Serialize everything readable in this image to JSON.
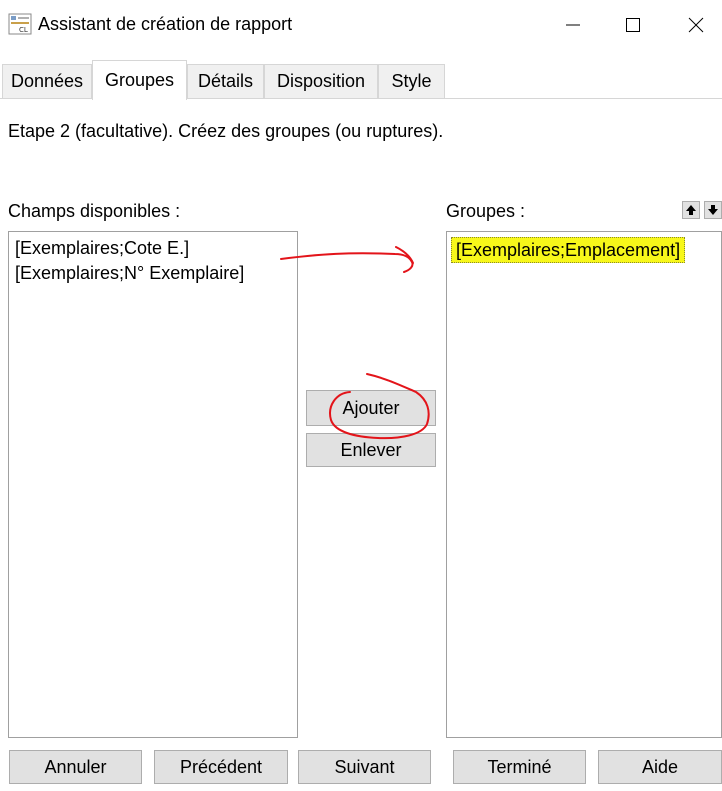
{
  "window": {
    "title": "Assistant de création de rapport",
    "icon": "report-wizard-icon",
    "controls": [
      "minimize-icon",
      "maximize-icon",
      "close-icon"
    ]
  },
  "tabs": [
    {
      "label": "Données",
      "active": false
    },
    {
      "label": "Groupes",
      "active": true
    },
    {
      "label": "Détails",
      "active": false
    },
    {
      "label": "Disposition",
      "active": false
    },
    {
      "label": "Style",
      "active": false
    }
  ],
  "instruction": "Etape 2 (facultative). Créez des groupes (ou ruptures).",
  "available": {
    "label": "Champs disponibles :",
    "items": [
      "[Exemplaires;Cote E.]",
      "[Exemplaires;N° Exemplaire]"
    ]
  },
  "groups": {
    "label": "Groupes :",
    "items": [
      "[Exemplaires;Emplacement]"
    ],
    "move_up_icon": "arrow-up-icon",
    "move_down_icon": "arrow-down-icon"
  },
  "actions": {
    "add": "Ajouter",
    "remove": "Enlever"
  },
  "footer": {
    "cancel": "Annuler",
    "previous": "Précédent",
    "next": "Suivant",
    "finish": "Terminé",
    "help": "Aide"
  },
  "colors": {
    "highlight": "#f7f71a",
    "annotation": "#e3141a",
    "button_face": "#e1e1e1",
    "tab_inactive": "#f0f0f0"
  }
}
